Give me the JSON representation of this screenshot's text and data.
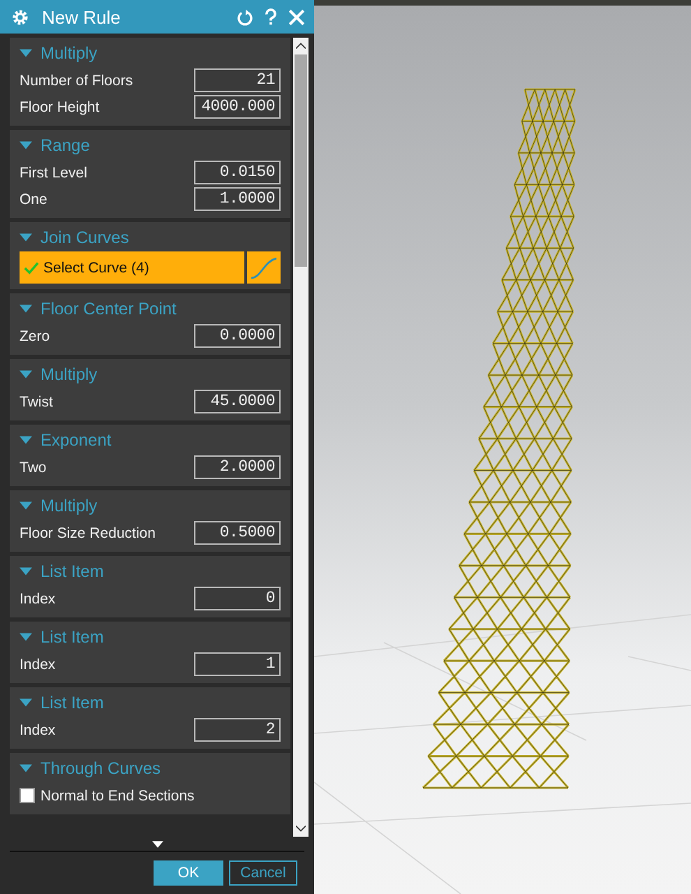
{
  "window": {
    "title": "New Rule"
  },
  "sections": [
    {
      "title": "Multiply",
      "expanded": true,
      "rows": [
        {
          "kind": "field",
          "label": "Number of Floors",
          "value": "21"
        },
        {
          "kind": "field",
          "label": "Floor Height",
          "value": "4000.000"
        }
      ]
    },
    {
      "title": "Range",
      "expanded": true,
      "rows": [
        {
          "kind": "field",
          "label": "First Level",
          "value": "0.0150"
        },
        {
          "kind": "field",
          "label": "One",
          "value": "1.0000"
        }
      ]
    },
    {
      "title": "Join Curves",
      "expanded": true,
      "rows": [
        {
          "kind": "select",
          "label": "Select Curve (4)",
          "selected": true
        }
      ]
    },
    {
      "title": "Floor Center Point",
      "expanded": true,
      "rows": [
        {
          "kind": "field",
          "label": "Zero",
          "value": "0.0000"
        }
      ]
    },
    {
      "title": "Multiply",
      "expanded": true,
      "rows": [
        {
          "kind": "field",
          "label": "Twist",
          "value": "45.0000"
        }
      ]
    },
    {
      "title": "Exponent",
      "expanded": true,
      "rows": [
        {
          "kind": "field",
          "label": "Two",
          "value": "2.0000"
        }
      ]
    },
    {
      "title": "Multiply",
      "expanded": true,
      "rows": [
        {
          "kind": "field",
          "label": "Floor Size Reduction",
          "value": "0.5000"
        }
      ]
    },
    {
      "title": "List Item",
      "expanded": true,
      "rows": [
        {
          "kind": "field",
          "label": "Index",
          "value": "0"
        }
      ]
    },
    {
      "title": "List Item",
      "expanded": true,
      "rows": [
        {
          "kind": "field",
          "label": "Index",
          "value": "1"
        }
      ]
    },
    {
      "title": "List Item",
      "expanded": true,
      "rows": [
        {
          "kind": "field",
          "label": "Index",
          "value": "2"
        }
      ]
    },
    {
      "title": "Through Curves",
      "expanded": true,
      "rows": [
        {
          "kind": "checkbox",
          "label": "Normal to End Sections",
          "checked": false
        }
      ]
    }
  ],
  "buttons": [
    {
      "label": "OK",
      "primary": true
    },
    {
      "label": "Cancel",
      "primary": false
    }
  ]
}
